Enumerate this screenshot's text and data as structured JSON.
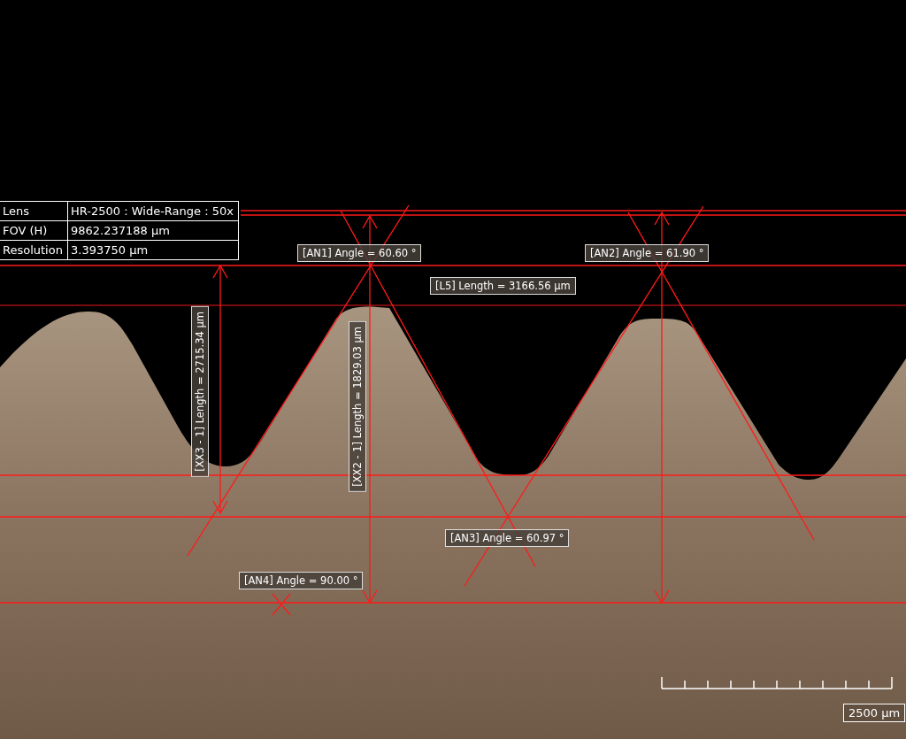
{
  "info_table": {
    "rows": [
      {
        "label": "Lens",
        "value": "HR-2500 : Wide-Range : 50x"
      },
      {
        "label": "FOV (H)",
        "value": "9862.237188 µm"
      },
      {
        "label": "Resolution",
        "value": "3.393750 µm"
      }
    ]
  },
  "measurements": [
    {
      "text": "[AN1] Angle = 60.60 °",
      "kind": "horizontal"
    },
    {
      "text": "[AN2] Angle = 61.90 °",
      "kind": "horizontal"
    },
    {
      "text": "[L5] Length = 3166.56 µm",
      "kind": "horizontal"
    },
    {
      "text": "[XX3 - 1] Length = 2715.34 µm",
      "kind": "vertical"
    },
    {
      "text": "[XX2 - 1] Length = 1829.03 µm",
      "kind": "vertical"
    },
    {
      "text": "[AN3] Angle = 60.97 °",
      "kind": "horizontal"
    },
    {
      "text": "[AN4] Angle = 90.00 °",
      "kind": "horizontal"
    }
  ],
  "scale_bar": {
    "label": "2500 µm"
  }
}
